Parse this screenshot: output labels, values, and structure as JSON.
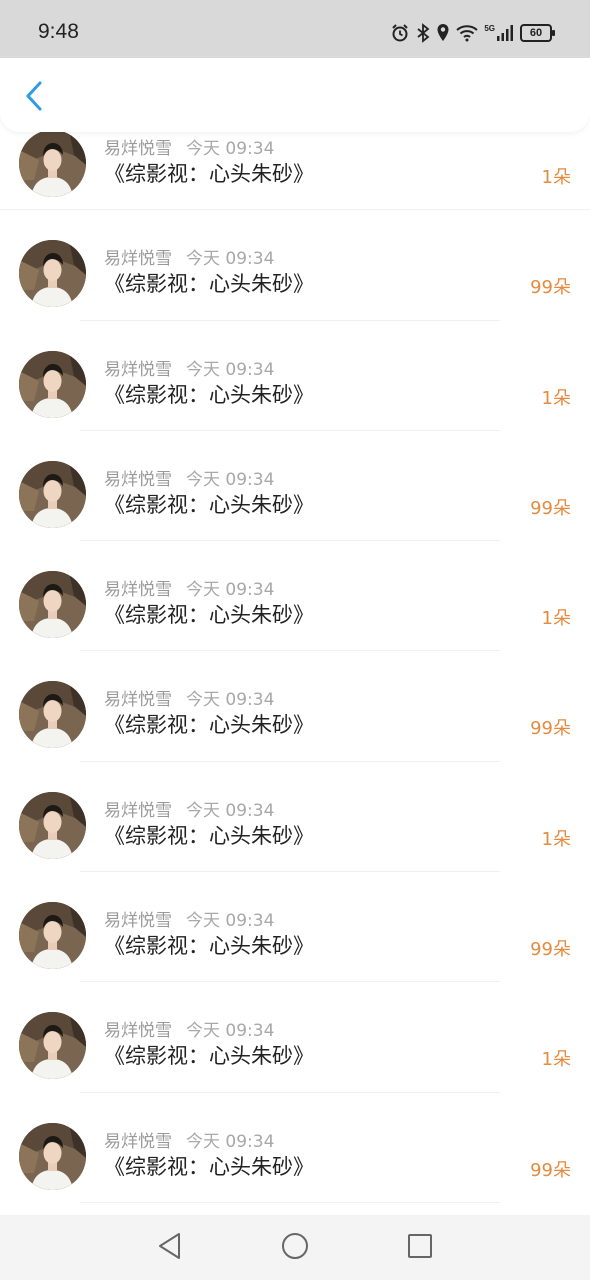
{
  "status_bar": {
    "time": "9:48",
    "network": "5G",
    "battery": "60",
    "icons": [
      "alarm-icon",
      "bluetooth-icon",
      "location-icon",
      "wifi-icon",
      "signal-icon",
      "battery-icon"
    ]
  },
  "header": {
    "back_icon": "chevron-left-icon",
    "accent_color": "#2e9be6"
  },
  "colors": {
    "amount": "#e58a3e",
    "sender": "#9a9a9a",
    "message": "#222222"
  },
  "rows": [
    {
      "sender": "易烊悦雪",
      "time": "今天 09:34",
      "message": "《综影视：心头朱砂》",
      "amount": "1朵"
    },
    {
      "sender": "易烊悦雪",
      "time": "今天 09:34",
      "message": "《综影视：心头朱砂》",
      "amount": "99朵"
    },
    {
      "sender": "易烊悦雪",
      "time": "今天 09:34",
      "message": "《综影视：心头朱砂》",
      "amount": "1朵"
    },
    {
      "sender": "易烊悦雪",
      "time": "今天 09:34",
      "message": "《综影视：心头朱砂》",
      "amount": "99朵"
    },
    {
      "sender": "易烊悦雪",
      "time": "今天 09:34",
      "message": "《综影视：心头朱砂》",
      "amount": "1朵"
    },
    {
      "sender": "易烊悦雪",
      "time": "今天 09:34",
      "message": "《综影视：心头朱砂》",
      "amount": "99朵"
    },
    {
      "sender": "易烊悦雪",
      "time": "今天 09:34",
      "message": "《综影视：心头朱砂》",
      "amount": "1朵"
    },
    {
      "sender": "易烊悦雪",
      "time": "今天 09:34",
      "message": "《综影视：心头朱砂》",
      "amount": "99朵"
    },
    {
      "sender": "易烊悦雪",
      "time": "今天 09:34",
      "message": "《综影视：心头朱砂》",
      "amount": "1朵"
    },
    {
      "sender": "易烊悦雪",
      "time": "今天 09:34",
      "message": "《综影视：心头朱砂》",
      "amount": "99朵"
    }
  ],
  "nav_bar": {
    "icons": [
      "back-triangle-icon",
      "home-circle-icon",
      "recents-square-icon"
    ]
  }
}
